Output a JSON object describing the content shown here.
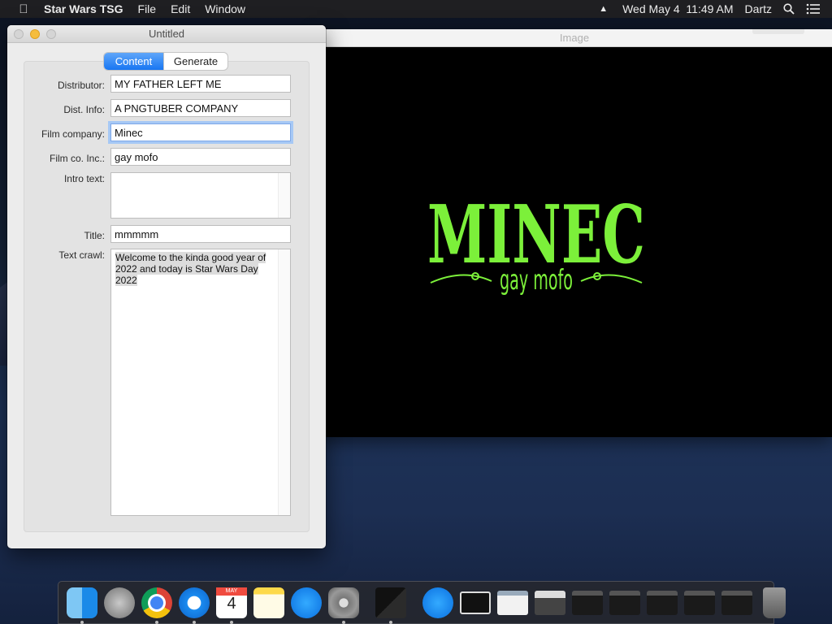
{
  "menubar": {
    "app_name": "Star Wars TSG",
    "menus": [
      "File",
      "Edit",
      "Window"
    ],
    "clock": "Wed May 4  11:49 AM",
    "user": "Dartz"
  },
  "image_window": {
    "title": "Image",
    "logo_text": "MINEC",
    "logo_subtext": "gay mofo",
    "logo_color": "#7cf03a"
  },
  "main_window": {
    "title": "Untitled",
    "tabs": [
      "Content",
      "Generate"
    ],
    "active_tab": "Content",
    "fields": {
      "distributor": {
        "label": "Distributor:",
        "value": "MY FATHER LEFT ME"
      },
      "dist_info": {
        "label": "Dist. Info:",
        "value": "A PNGTUBER COMPANY"
      },
      "film_company": {
        "label": "Film company:",
        "value": "Minec"
      },
      "film_co_inc": {
        "label": "Film co. Inc.:",
        "value": "gay mofo"
      },
      "intro_text": {
        "label": "Intro text:",
        "value": ""
      },
      "title": {
        "label": "Title:",
        "value": "mmmmm"
      },
      "text_crawl": {
        "label": "Text crawl:",
        "value": "Welcome to the kinda good year of 2022 and today is Star Wars Day 2022"
      }
    }
  },
  "dock": {
    "calendar_month": "MAY",
    "calendar_day": "4"
  },
  "colors": {
    "accent": "#1876f2",
    "menubar_bg": "#1f1f22"
  }
}
